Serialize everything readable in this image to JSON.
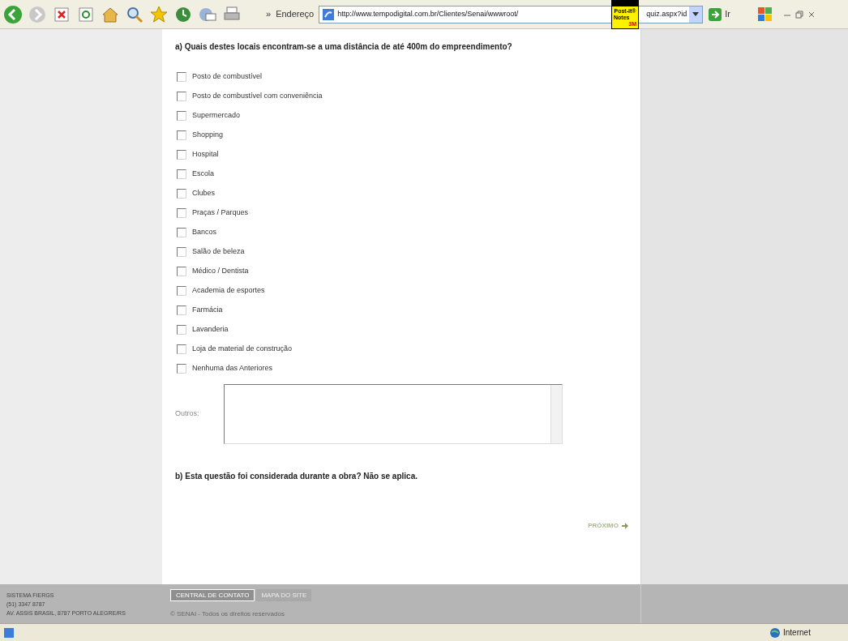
{
  "toolbar": {
    "overflow": "»",
    "address_label": "Endereço",
    "address": "http://www.tempodigital.com.br/Clientes/Senai/wwwroot/",
    "address_tail": "quiz.aspx?id",
    "go": "Ir",
    "sticky_note": {
      "line1": "Post-it®",
      "line2": "Notes",
      "brand": "3M"
    }
  },
  "question_a": "a) Quais destes locais encontram-se a uma distância de até 400m do empreendimento?",
  "options": [
    {
      "label": "Posto de combustível",
      "checked": false
    },
    {
      "label": "Posto de combustível com conveniência",
      "checked": false
    },
    {
      "label": "Supermercado",
      "checked": false
    },
    {
      "label": "Shopping",
      "checked": false
    },
    {
      "label": "Hospital",
      "checked": false
    },
    {
      "label": "Escola",
      "checked": false
    },
    {
      "label": "Clubes",
      "checked": false
    },
    {
      "label": "Praças / Parques",
      "checked": false
    },
    {
      "label": "Bancos",
      "checked": false
    },
    {
      "label": "Salão de beleza",
      "checked": false
    },
    {
      "label": "Médico / Dentista",
      "checked": false
    },
    {
      "label": "Academia de esportes",
      "checked": false
    },
    {
      "label": "Farmácia",
      "checked": false
    },
    {
      "label": "Lavanderia",
      "checked": false
    },
    {
      "label": "Loja de material de construção",
      "checked": false
    },
    {
      "label": "Nenhuma das Anteriores",
      "checked": false
    }
  ],
  "others_label": "Outros:",
  "question_b": "b) Esta questão foi considerada durante a obra? Não se aplica.",
  "next": "PRÓXIMO",
  "footer": {
    "lines": [
      "SISTEMA FIERGS",
      "(51) 3347 8787",
      "AV. ASSIS BRASIL, 8787 PORTO ALEGRE/RS"
    ],
    "tabs": [
      {
        "label": "CENTRAL DE CONTATO",
        "selected": true
      },
      {
        "label": "MAPA DO SITE",
        "selected": false
      }
    ],
    "copyright": "© SENAI - Todos os direitos reservados"
  },
  "status_bar": {
    "zone": "Internet"
  }
}
